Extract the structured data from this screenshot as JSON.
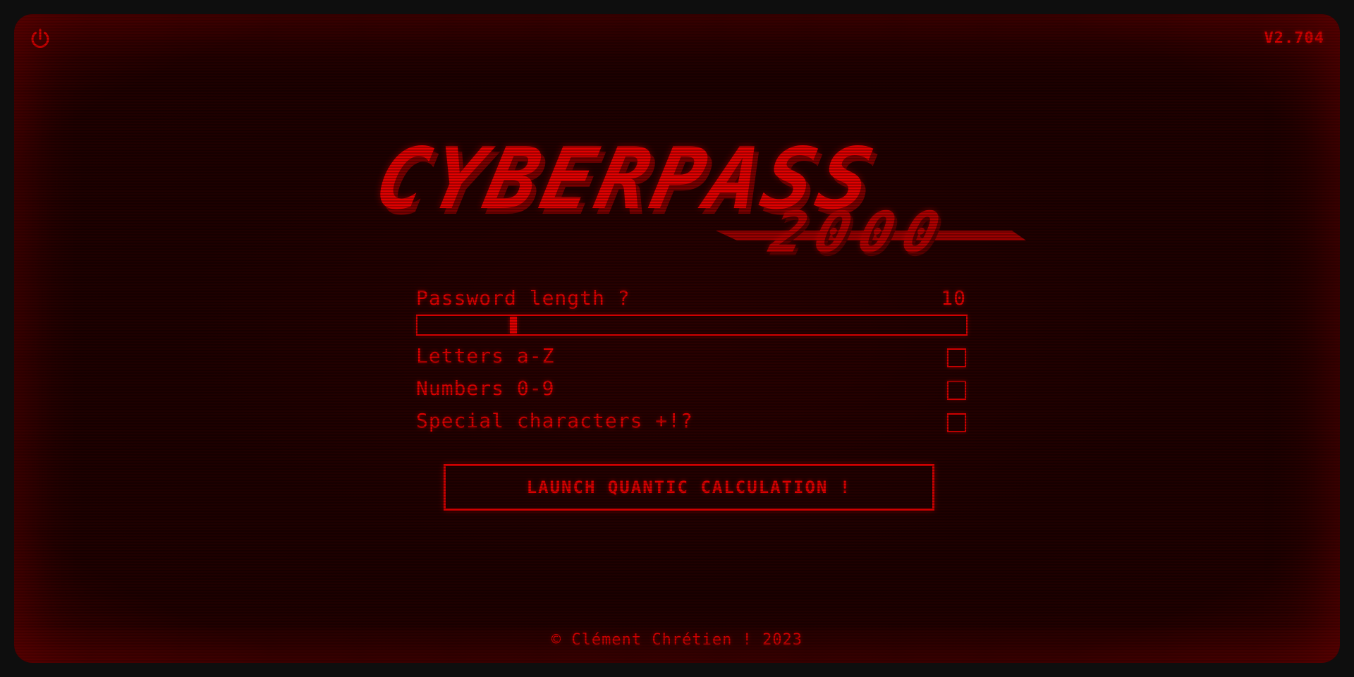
{
  "app": {
    "version": "V2.704",
    "power_icon": "power-icon",
    "accent_color": "#e00000",
    "background_color": "#1e0000"
  },
  "logo": {
    "main_text": "CYBERPASS",
    "sub_text": "2000"
  },
  "form": {
    "length_label": "Password length ?",
    "length_value": "10",
    "length_fraction": 0.17,
    "options": [
      {
        "label": "Letters a-Z",
        "checked": false
      },
      {
        "label": "Numbers 0-9",
        "checked": false
      },
      {
        "label": "Special characters +!?",
        "checked": false
      }
    ]
  },
  "actions": {
    "launch_label": "LAUNCH QUANTIC CALCULATION !"
  },
  "footer": {
    "text": "© Clément Chrétien ! 2023"
  }
}
